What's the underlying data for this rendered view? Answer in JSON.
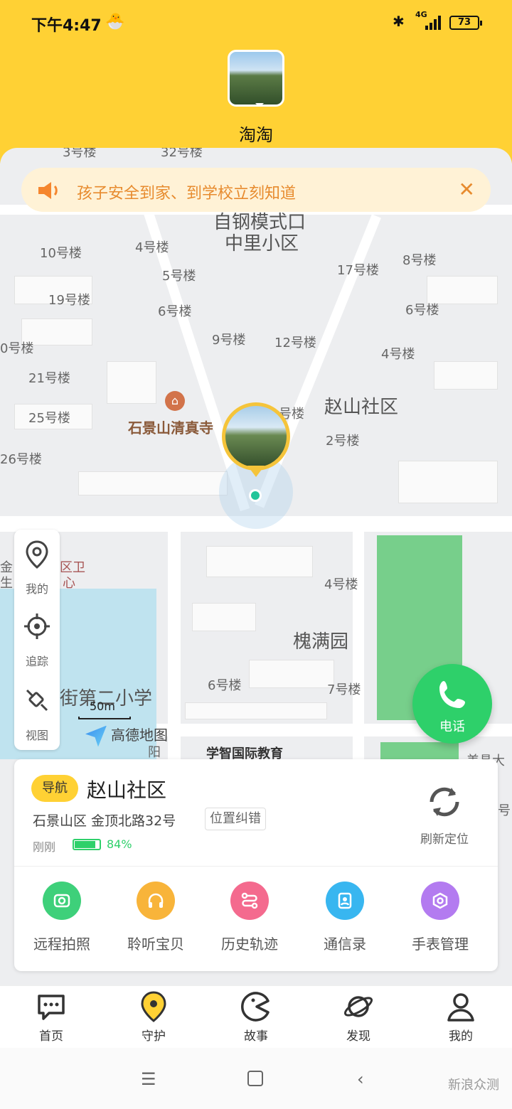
{
  "status_bar": {
    "time": "下午4:47",
    "emoji": "🐣",
    "network": "4G",
    "battery": "73"
  },
  "header": {
    "pet_name": "淘淘"
  },
  "banner": {
    "text": "孩子安全到家、到学校立刻知道",
    "close": "✕"
  },
  "map": {
    "labels": [
      "3号楼",
      "32号楼",
      "自钢模式口",
      "中里小区",
      "10号楼",
      "4号楼",
      "17号楼",
      "8号楼",
      "5号楼",
      "19号楼",
      "6号楼",
      "6号楼",
      "9号楼",
      "12号楼",
      "0号楼",
      "4号楼",
      "21号楼",
      "号楼",
      "赵山社区",
      "25号楼",
      "2号楼",
      "石景山清真寺",
      "26号楼",
      "金",
      "生",
      "区卫",
      "心",
      "4号楼",
      "槐满园",
      "6号楼",
      "7号楼",
      "街第二小学",
      "阳",
      "学智国际教育",
      "美具大",
      "号"
    ],
    "scale": "50m",
    "provider": "高德地图"
  },
  "tools": [
    {
      "label": "我的",
      "icon": "location-pin-icon"
    },
    {
      "label": "追踪",
      "icon": "crosshair-icon"
    },
    {
      "label": "视图",
      "icon": "satellite-view-icon"
    }
  ],
  "call_button": {
    "label": "电话"
  },
  "location_card": {
    "nav_badge": "导航",
    "place": "赵山社区",
    "address": "石景山区 金顶北路32号",
    "correction": "位置纠错",
    "time_ago": "刚刚",
    "battery_percent": "84%",
    "battery_level": 0.84,
    "refresh_label": "刷新定位"
  },
  "features": [
    {
      "label": "远程拍照",
      "icon": "camera-icon",
      "color": "#3ED07A"
    },
    {
      "label": "聆听宝贝",
      "icon": "headphones-icon",
      "color": "#F8B43A"
    },
    {
      "label": "历史轨迹",
      "icon": "route-icon",
      "color": "#F46A8E"
    },
    {
      "label": "通信录",
      "icon": "contacts-icon",
      "color": "#38B6F0"
    },
    {
      "label": "手表管理",
      "icon": "watch-settings-icon",
      "color": "#B37BF0"
    }
  ],
  "tabs": [
    {
      "label": "首页",
      "icon": "chat-icon"
    },
    {
      "label": "守护",
      "icon": "guard-pin-icon"
    },
    {
      "label": "故事",
      "icon": "story-icon"
    },
    {
      "label": "发现",
      "icon": "planet-icon"
    },
    {
      "label": "我的",
      "icon": "profile-icon"
    }
  ],
  "watermark": "新浪众测",
  "colors": {
    "brand": "#FFD134",
    "accent_green": "#2ED06A",
    "banner_text": "#E78B2E"
  }
}
